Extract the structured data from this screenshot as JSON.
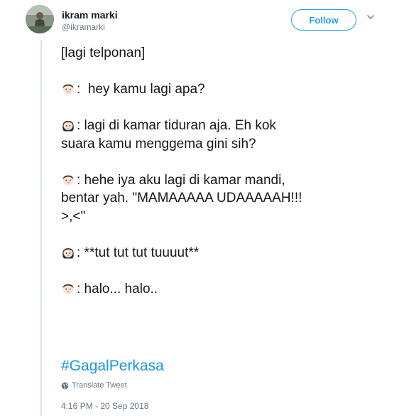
{
  "user": {
    "name": "ikram marki",
    "handle": "@ikramarki"
  },
  "follow_label": "Follow",
  "tweet": {
    "header": "[lagi telponan]",
    "m1": ":  hey kamu lagi apa?",
    "f1a": ": lagi di kamar tiduran aja. Eh kok",
    "f1b": "suara kamu menggema gini sih?",
    "m2a": ": hehe iya aku lagi di kamar mandi,",
    "m2b": "bentar yah. \"MAMAAAAA UDAAAAAH!!!",
    "m2c": ">,<\"",
    "f2": ": **tut tut tut tuuuut**",
    "m3": ": halo... halo.."
  },
  "hashtag": "#GagalPerkasa",
  "translate_label": "Translate Tweet",
  "timestamp": "4:16 PM - 20 Sep 2018",
  "icons": {
    "boy": "boy-face-emoji",
    "girl": "girl-face-emoji",
    "globe": "globe-icon",
    "chevron": "chevron-down-icon"
  },
  "colors": {
    "accent": "#1da1f2",
    "hashtag": "#1b95e0",
    "muted": "#657786",
    "thread_line": "#d0e5f5"
  }
}
